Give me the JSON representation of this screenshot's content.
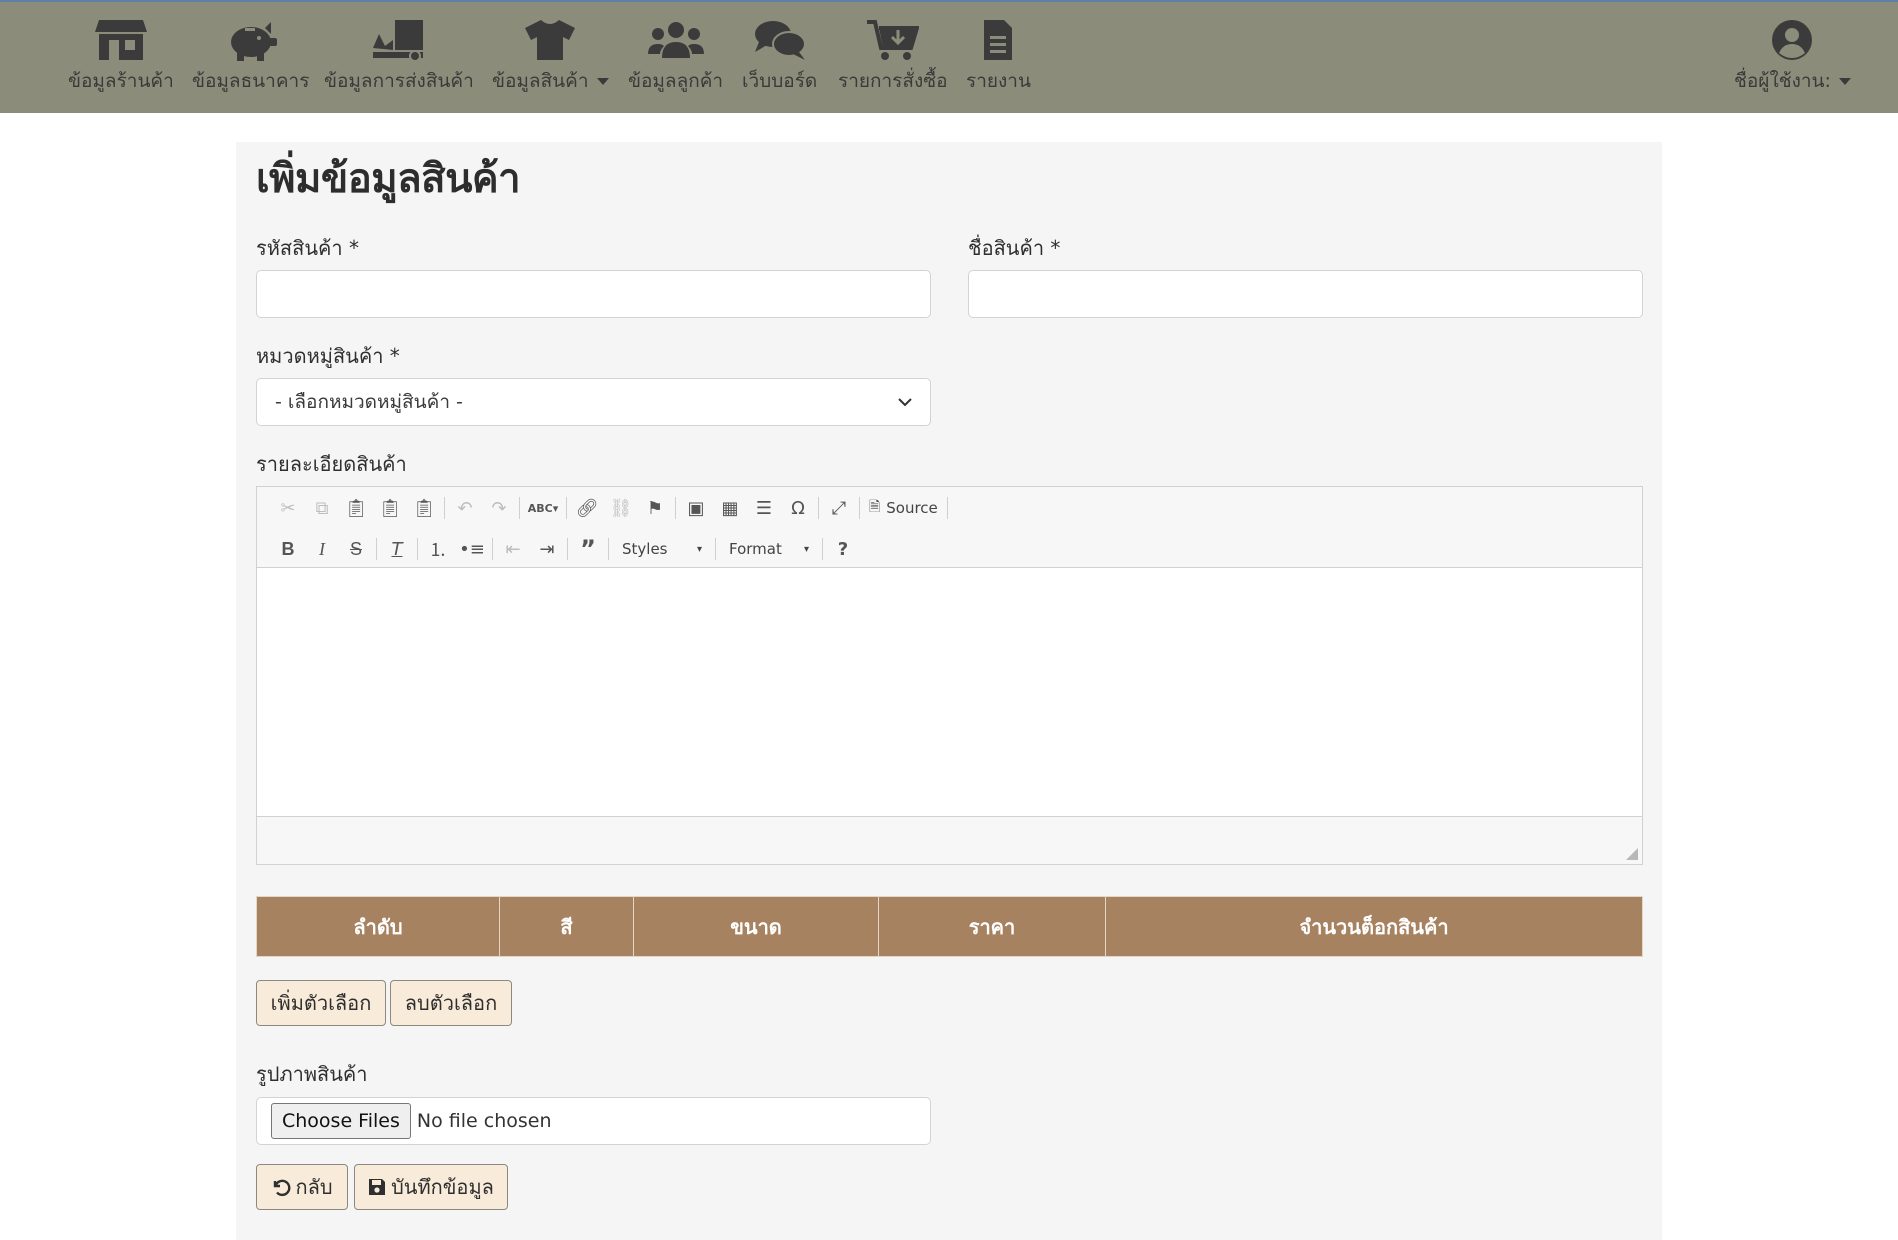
{
  "nav": {
    "items": [
      {
        "label": "ข้อมูลร้านค้า",
        "icon": "store-icon"
      },
      {
        "label": "ข้อมูลธนาคาร",
        "icon": "piggy-bank-icon"
      },
      {
        "label": "ข้อมูลการส่งสินค้า",
        "icon": "shipping-icon"
      },
      {
        "label": "ข้อมูลสินค้า",
        "icon": "tshirt-icon"
      },
      {
        "label": "ข้อมูลลูกค้า",
        "icon": "users-icon"
      },
      {
        "label": "เว็บบอร์ด",
        "icon": "comments-icon"
      },
      {
        "label": "รายการสั่งซื้อ",
        "icon": "cart-icon"
      },
      {
        "label": "รายงาน",
        "icon": "file-icon"
      }
    ],
    "user_label": "ชื่อผู้ใช้งาน:"
  },
  "form": {
    "title": "เพิ่มข้อมูลสินค้า",
    "code_label": "รหัสสินค้า *",
    "code_value": "",
    "name_label": "ชื่อสินค้า *",
    "name_value": "",
    "category_label": "หมวดหมู่สินค้า *",
    "category_selected": "- เลือกหมวดหมู่สินค้า -",
    "detail_label": "รายละเอียดสินค้า",
    "image_label": "รูปภาพสินค้า"
  },
  "editor": {
    "source_label": "Source",
    "styles_label": "Styles",
    "format_label": "Format"
  },
  "options_table": {
    "headers": [
      "ลำดับ",
      "สี",
      "ขนาด",
      "ราคา",
      "จำนวนต็อกสินค้า"
    ]
  },
  "buttons": {
    "add_option": "เพิ่มตัวเลือก",
    "remove_option": "ลบตัวเลือก",
    "choose_files": "Choose Files",
    "no_file": "No file chosen",
    "back": "กลับ",
    "save": "บันทึกข้อมูล"
  }
}
